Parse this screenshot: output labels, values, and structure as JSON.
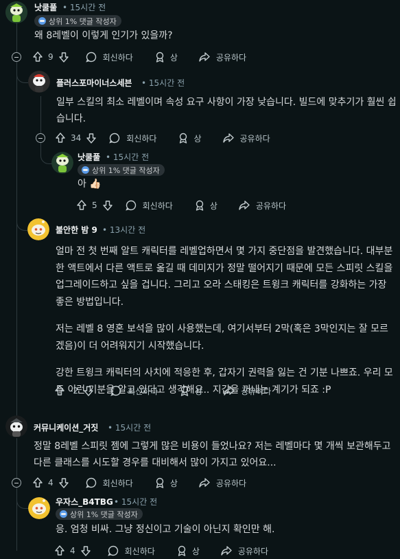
{
  "comments": [
    {
      "username": "낫쿨풀",
      "time": "15시간 전",
      "flair": "상위 1% 댓글 작성자",
      "text": [
        "왜 8레벨이 이렇게 인기가 있을까?"
      ],
      "votes": "9",
      "reply": "회신하다",
      "award": "상",
      "share": "공유하다"
    },
    {
      "username": "플러스포마이너스세븐",
      "time": "15시간 전",
      "text": [
        "일부 스킬의 최소 레벨이며 속성 요구 사항이 가장 낮습니다. 빌드에 맞추기가 훨씬 쉽습니다."
      ],
      "votes": "34",
      "reply": "회신하다",
      "award": "상",
      "share": "공유하다"
    },
    {
      "username": "낫쿨풀",
      "time": "15시간 전",
      "flair": "상위 1% 댓글 작성자",
      "text": [
        "아 👍🏻"
      ],
      "votes": "5",
      "reply": "회신하다",
      "award": "상",
      "share": "공유하다"
    },
    {
      "username": "불안한 밤 9",
      "time": "13시간 전",
      "text": [
        "얼마 전 첫 번째 알트 캐릭터를 레벨업하면서 몇 가지 중단점을 발견했습니다. 대부분 한 액트에서 다른 액트로 옮길 때 데미지가 정말 떨어지기 때문에 모든 스피릿 스킬을 업그레이드하고 싶을 겁니다. 그리고 오라 스태킹은 트윙크 캐릭터를 강화하는 가장 좋은 방법입니다.",
        "저는 레벨 8 영혼 보석을 많이 사용했는데, 여기서부터 2막(혹은 3막인지는 잘 모르겠음)이 더 어려워지기 시작했습니다.",
        "강한 트윙크 캐릭터의 사치에 적응한 후, 갑자기 권력을 잃는 건 기분 나쁘죠. 우리 모두 이런 기분을 알고 있다고 생각해요.. 지갑을 꺼내는 계기가 되죠 :P"
      ],
      "votes": "-2",
      "reply": "회신하다",
      "award": "상",
      "share": "공유하다"
    },
    {
      "username": "커뮤니케이션_거짓",
      "time": "15시간 전",
      "text": [
        "정말 8레벨 스피릿 젬에 그렇게 많은 비용이 들었나요? 저는 레벨마다 몇 개씩 보관해두고 다른 클래스를 시도할 경우를 대비해서 많이 가지고 있어요..."
      ],
      "votes": "4",
      "reply": "회신하다",
      "award": "상",
      "share": "공유하다"
    },
    {
      "username": "우자스_B4TBG",
      "time": "15시간 전",
      "flair": "상위 1% 댓글 작성자",
      "text": [
        "응. 엄청 비싸. 그냥 정신이고 기술이 아닌지 확인만 해."
      ],
      "votes": "4",
      "reply": "회신하다",
      "award": "상",
      "share": "공유하다"
    }
  ],
  "separator": "•",
  "colors": {
    "background": "#0b1416",
    "thread_line": "#2f3b3f",
    "meta": "#8ba2ad",
    "text": "#d7dadc"
  },
  "icons": [
    "upvote-icon",
    "downvote-icon",
    "reply-bubble-icon",
    "award-icon",
    "share-arrow-icon",
    "collapse-minus-icon",
    "flair-icon"
  ]
}
